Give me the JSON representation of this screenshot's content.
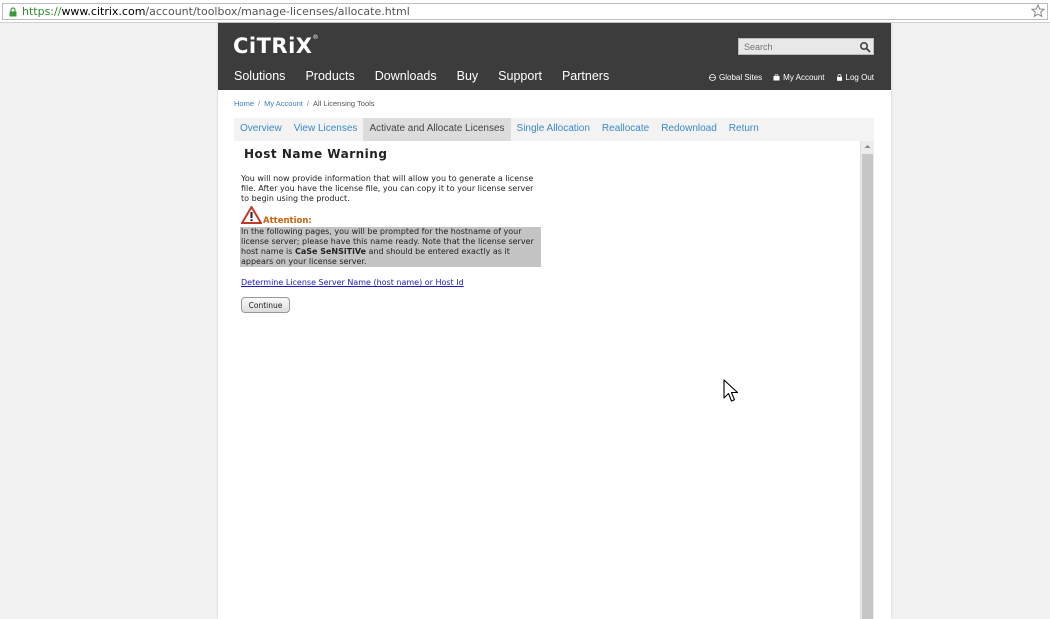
{
  "browser": {
    "url_scheme": "https://",
    "url_host": "www.citrix.com",
    "url_path": "/account/toolbox/manage-licenses/allocate.html"
  },
  "header": {
    "logo": "CiTRiX",
    "logo_mark": "®",
    "search_placeholder": "Search",
    "nav": [
      "Solutions",
      "Products",
      "Downloads",
      "Buy",
      "Support",
      "Partners"
    ],
    "util": [
      "Global Sites",
      "My Account",
      "Log Out"
    ]
  },
  "breadcrumb": {
    "home": "Home",
    "sep": "/",
    "my_account": "My Account",
    "current": "All Licensing Tools"
  },
  "tabs": [
    "Overview",
    "View Licenses",
    "Activate and Allocate Licenses",
    "Single Allocation",
    "Reallocate",
    "Redownload",
    "Return"
  ],
  "content": {
    "title": "Host Name Warning",
    "intro": "You will now provide information that will allow you to generate a license file. After you have the license file, you can copy it to your license server to begin using the product.",
    "attention_label": "Attention:",
    "att_pre": "In the following pages, you will be prompted for the hostname of your license server; please have this name ready. Note that the license server host name is ",
    "att_bold": "CaSe SeNSiTiVe",
    "att_post": " and should be entered exactly as it appears on your license server.",
    "link": "Determine License Server Name (host name) or Host Id",
    "continue": "Continue"
  },
  "colors": {
    "header_bg": "#3c3c3c",
    "link_blue": "#3a8ac8",
    "attention_orange": "#c8620e",
    "warning_red": "#c0392b"
  }
}
